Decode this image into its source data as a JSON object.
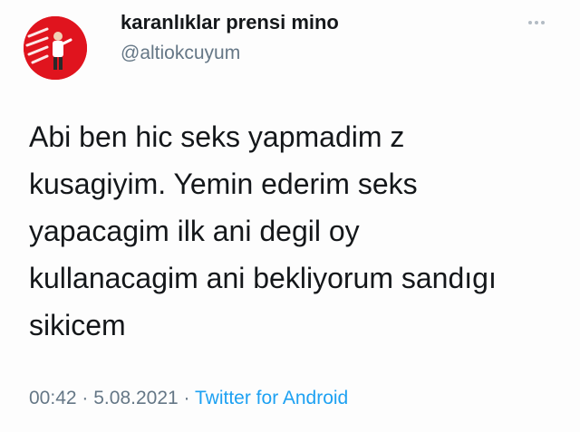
{
  "tweet": {
    "display_name": "karanlıklar prensi mino",
    "handle": "@altiokcuyum",
    "text_lines": [
      "Abi ben hic seks yapmadim z",
      "kusagiyim. Yemin ederim seks",
      "yapacagim ilk ani degil oy",
      "kullanacagim ani bekliyorum sandıgı",
      "sikicem"
    ],
    "time": "00:42",
    "separator": "·",
    "date": "5.08.2021",
    "source": "Twitter for Android"
  },
  "icons": {
    "avatar": "profile-photo",
    "more": "more-options-icon"
  },
  "colors": {
    "avatar_background": "#e0141e",
    "source_link": "#1da1f2",
    "secondary_text": "#657786"
  }
}
